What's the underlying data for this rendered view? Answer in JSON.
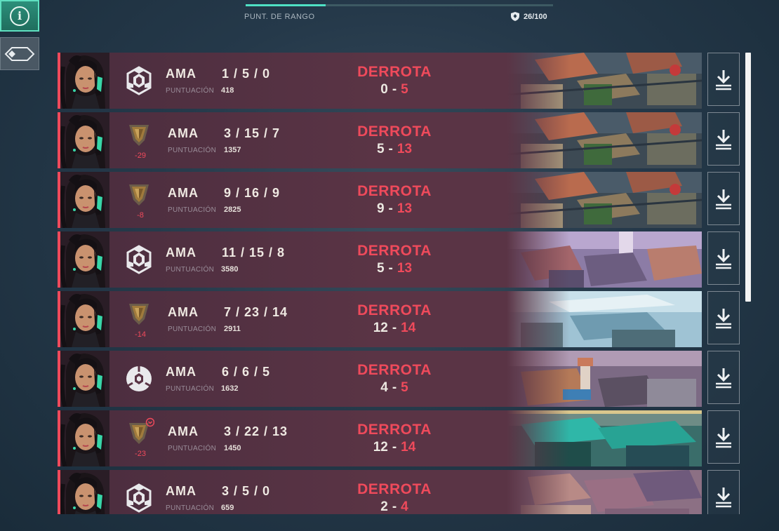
{
  "top": {
    "rank_progress_label": "PUNT. DE RANGO",
    "rank_progress_value": "26/100",
    "rank_progress_fraction": 0.26
  },
  "icons": {
    "info": "info-icon",
    "side_tab": "diamond-tab-icon",
    "rank_shield": "shield-icon",
    "download": "download-icon"
  },
  "colors": {
    "defeat": "#ef4a5b",
    "accent_teal": "#4fe0c4",
    "card_bg": "#5a3445"
  },
  "score_label": "PUNTUACIÓN",
  "matches": [
    {
      "agent": "AMA",
      "kda": "1 / 5 / 0",
      "score": "418",
      "result": "DERROTA",
      "team_rounds": "0",
      "enemy_rounds": "5",
      "rank_delta": "",
      "rank_type": "unrated",
      "map_style": "ascent"
    },
    {
      "agent": "AMA",
      "kda": "3 / 15 / 7",
      "score": "1357",
      "result": "DERROTA",
      "team_rounds": "5",
      "enemy_rounds": "13",
      "rank_delta": "-29",
      "rank_type": "bronze",
      "map_style": "ascent"
    },
    {
      "agent": "AMA",
      "kda": "9 / 16 / 9",
      "score": "2825",
      "result": "DERROTA",
      "team_rounds": "9",
      "enemy_rounds": "13",
      "rank_delta": "-8",
      "rank_type": "bronze",
      "map_style": "ascent"
    },
    {
      "agent": "AMA",
      "kda": "11 / 15 / 8",
      "score": "3580",
      "result": "DERROTA",
      "team_rounds": "5",
      "enemy_rounds": "13",
      "rank_delta": "",
      "rank_type": "unrated",
      "map_style": "split"
    },
    {
      "agent": "AMA",
      "kda": "7 / 23 / 14",
      "score": "2911",
      "result": "DERROTA",
      "team_rounds": "12",
      "enemy_rounds": "14",
      "rank_delta": "-14",
      "rank_type": "bronze",
      "map_style": "icebox"
    },
    {
      "agent": "AMA",
      "kda": "6 / 6 / 5",
      "score": "1632",
      "result": "DERROTA",
      "team_rounds": "4",
      "enemy_rounds": "5",
      "rank_delta": "",
      "rank_type": "spike",
      "map_style": "bind"
    },
    {
      "agent": "AMA",
      "kda": "3 / 22 / 13",
      "score": "1450",
      "result": "DERROTA",
      "team_rounds": "12",
      "enemy_rounds": "14",
      "rank_delta": "-23",
      "rank_type": "bronze-derank",
      "map_style": "haven"
    },
    {
      "agent": "AMA",
      "kda": "3 / 5 / 0",
      "score": "659",
      "result": "DERROTA",
      "team_rounds": "2",
      "enemy_rounds": "4",
      "rank_delta": "",
      "rank_type": "unrated",
      "map_style": "breeze"
    }
  ]
}
